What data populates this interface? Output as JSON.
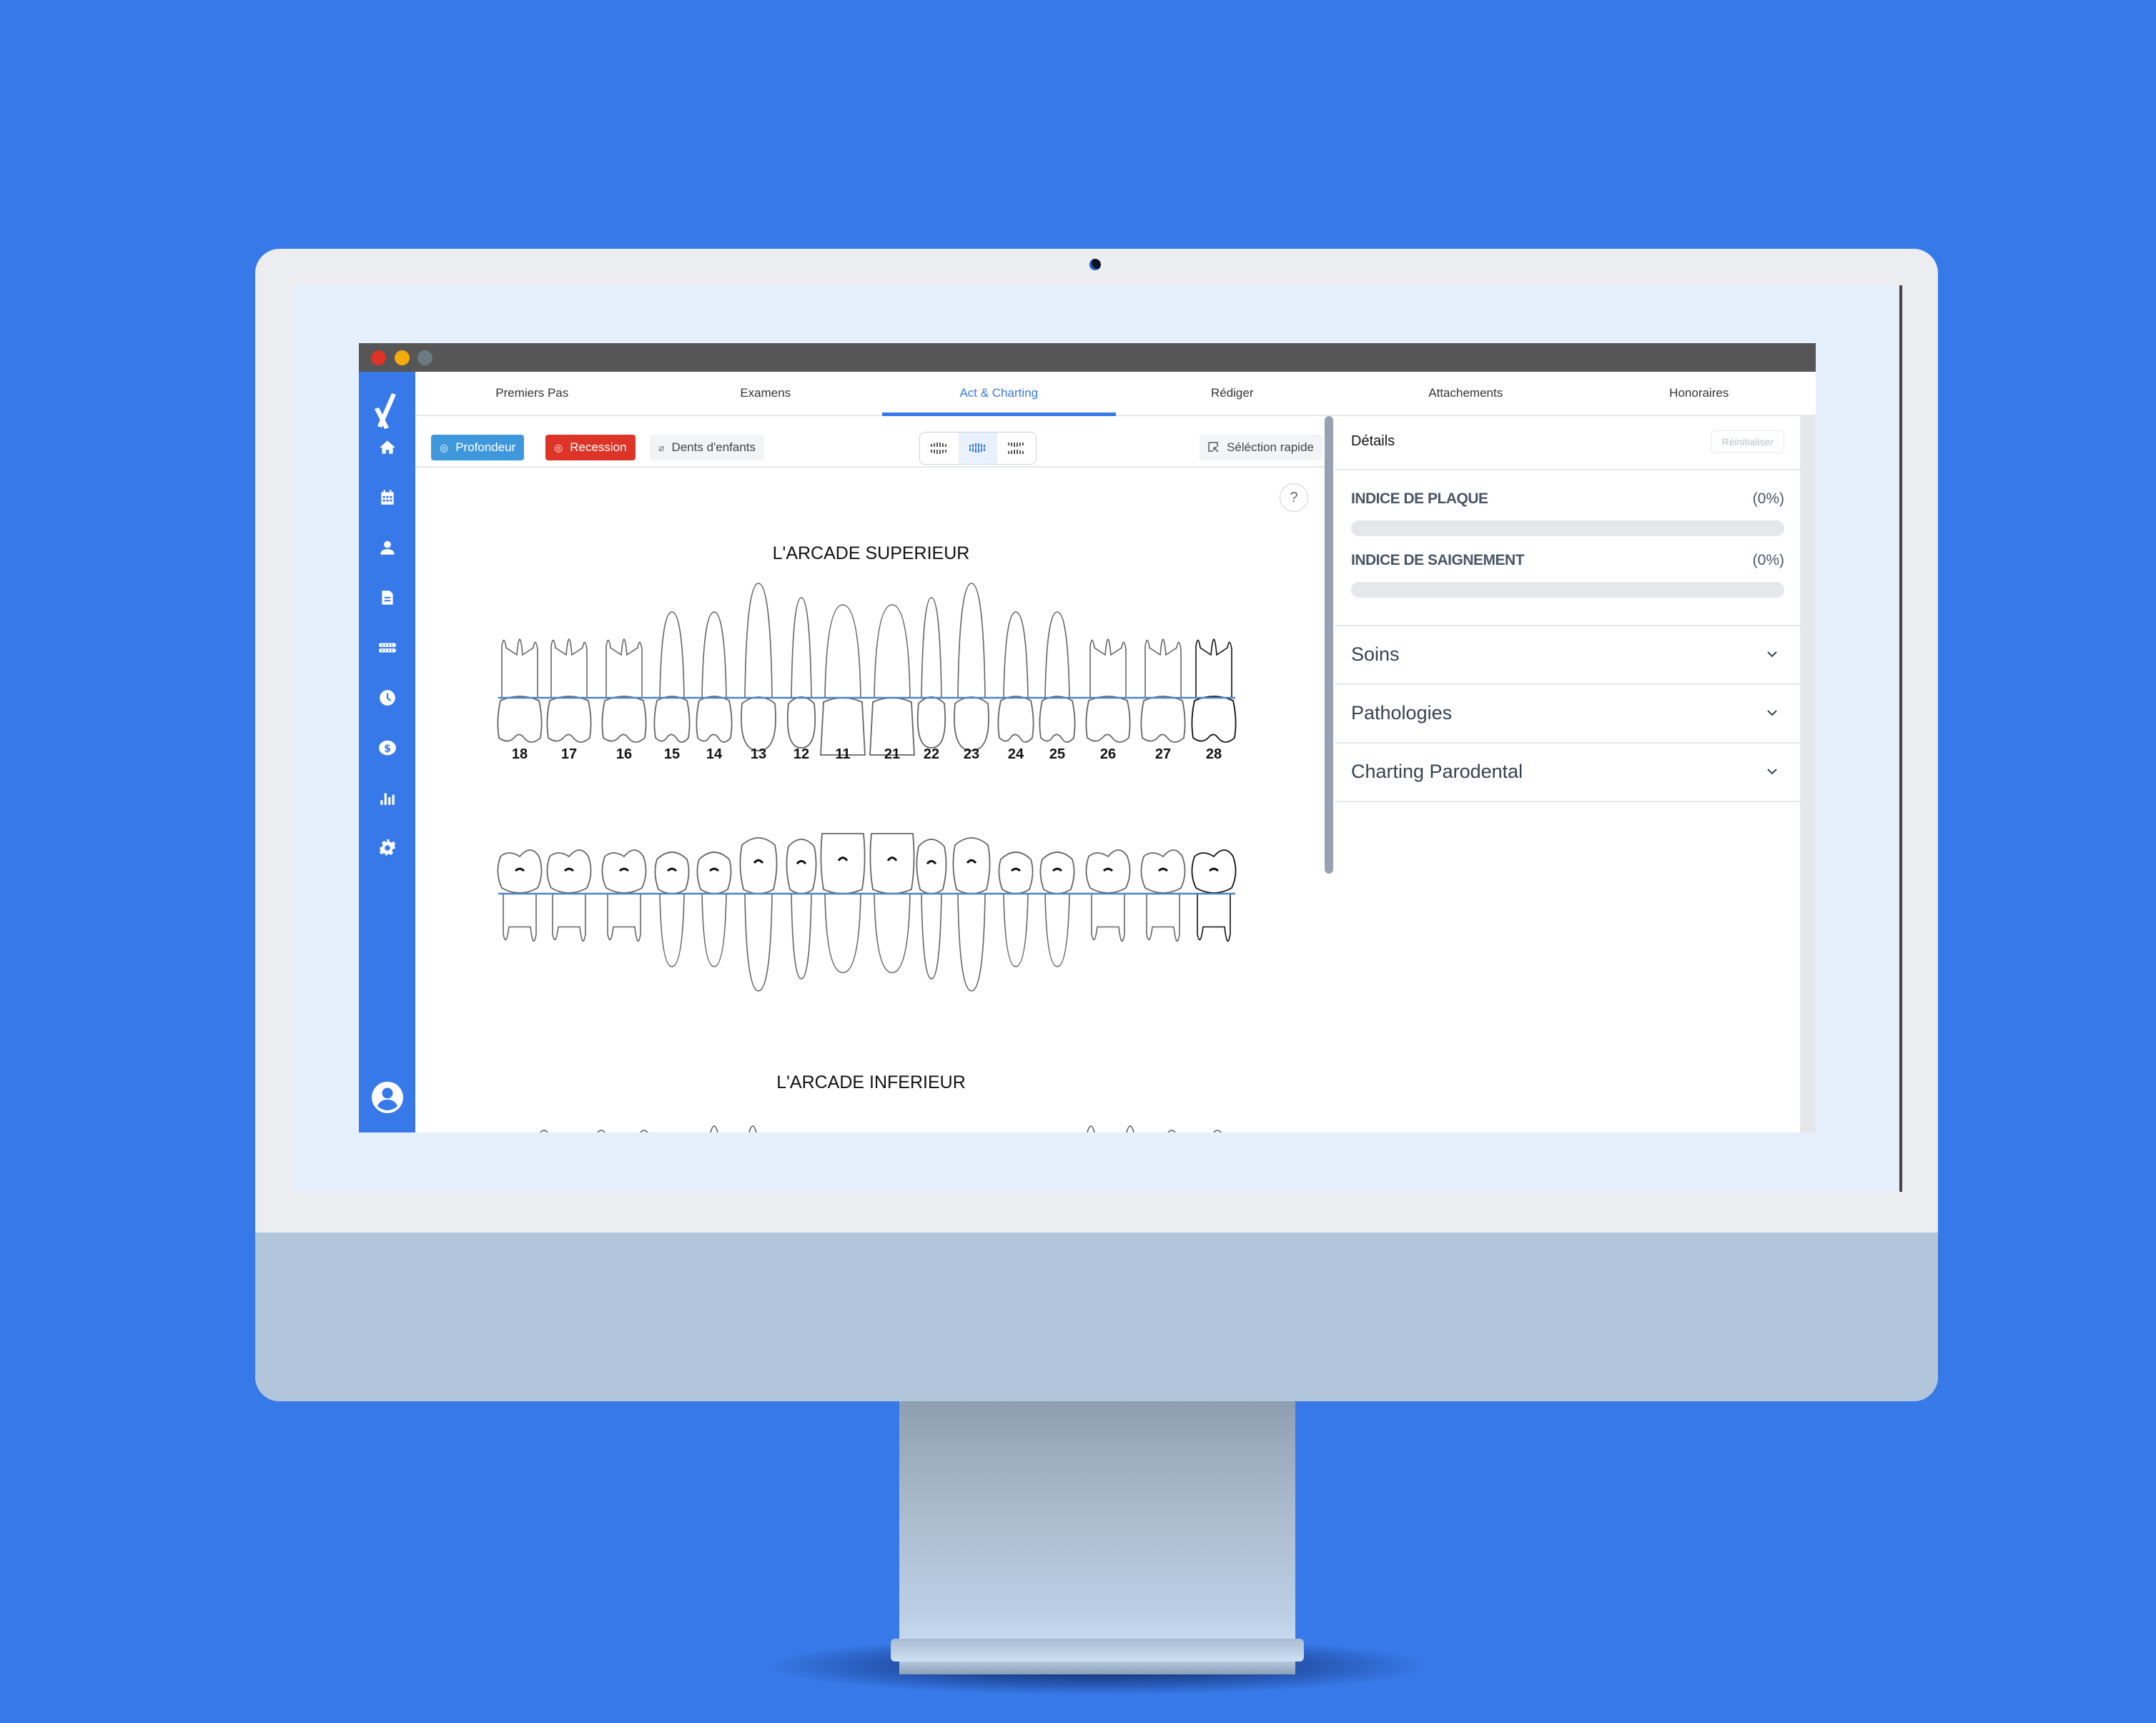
{
  "window": {
    "traffic_lights": [
      "close",
      "minimize",
      "maximize"
    ],
    "colors": {
      "close": "#dd3427",
      "minimize": "#f4ab0c",
      "maximize": "#6c7b83"
    }
  },
  "brand": {
    "accent": "#3779e8",
    "logo_icon": "check-x-logo-icon"
  },
  "sidebar": {
    "items": [
      {
        "icon": "home-icon",
        "label": "Accueil"
      },
      {
        "icon": "calendar-icon",
        "label": "Agenda"
      },
      {
        "icon": "user-icon",
        "label": "Patients"
      },
      {
        "icon": "document-icon",
        "label": "Documents"
      },
      {
        "icon": "teeth-icon",
        "label": "Charting"
      },
      {
        "icon": "clock-icon",
        "label": "Historique"
      },
      {
        "icon": "dollar-icon",
        "label": "Paiements"
      },
      {
        "icon": "bar-chart-icon",
        "label": "Statistiques"
      },
      {
        "icon": "gear-icon",
        "label": "Paramètres"
      }
    ],
    "profile_icon": "account-circle-icon"
  },
  "tabs": [
    {
      "label": "Premiers Pas",
      "active": false
    },
    {
      "label": "Examens",
      "active": false
    },
    {
      "label": "Act & Charting",
      "active": true
    },
    {
      "label": "Rédiger",
      "active": false
    },
    {
      "label": "Attachements",
      "active": false
    },
    {
      "label": "Honoraires",
      "active": false
    }
  ],
  "toolbar": {
    "profondeur_label": "Profondeur",
    "recession_label": "Recession",
    "dents_enfants_label": "Dents d'enfants",
    "view_modes": [
      {
        "icon": "both-arches-apart-icon",
        "active": false
      },
      {
        "icon": "both-arches-closed-icon",
        "active": true
      },
      {
        "icon": "arches-inverted-icon",
        "active": false
      }
    ],
    "quick_select_label": "Séléction rapide"
  },
  "chart": {
    "help_label": "?",
    "upper_title": "L'ARCADE SUPERIEUR",
    "lower_title": "L'ARCADE INFERIEUR",
    "upper_teeth": [
      {
        "num": "18",
        "type": "molar"
      },
      {
        "num": "17",
        "type": "molar"
      },
      {
        "num": "16",
        "type": "molar"
      },
      {
        "num": "15",
        "type": "premolar"
      },
      {
        "num": "14",
        "type": "premolar"
      },
      {
        "num": "13",
        "type": "canine"
      },
      {
        "num": "12",
        "type": "lateral"
      },
      {
        "num": "11",
        "type": "central"
      },
      {
        "num": "21",
        "type": "central"
      },
      {
        "num": "22",
        "type": "lateral"
      },
      {
        "num": "23",
        "type": "canine"
      },
      {
        "num": "24",
        "type": "premolar"
      },
      {
        "num": "25",
        "type": "premolar"
      },
      {
        "num": "26",
        "type": "molar"
      },
      {
        "num": "27",
        "type": "molar"
      },
      {
        "num": "28",
        "type": "molar",
        "selected": true
      }
    ],
    "lower_view_teeth": [
      {
        "num": "18",
        "type": "molar"
      },
      {
        "num": "17",
        "type": "molar"
      },
      {
        "num": "16",
        "type": "molar"
      },
      {
        "num": "15",
        "type": "premolar"
      },
      {
        "num": "14",
        "type": "premolar"
      },
      {
        "num": "13",
        "type": "canine"
      },
      {
        "num": "12",
        "type": "lateral"
      },
      {
        "num": "11",
        "type": "central"
      },
      {
        "num": "21",
        "type": "central"
      },
      {
        "num": "22",
        "type": "lateral"
      },
      {
        "num": "23",
        "type": "canine"
      },
      {
        "num": "24",
        "type": "premolar"
      },
      {
        "num": "25",
        "type": "premolar"
      },
      {
        "num": "26",
        "type": "molar"
      },
      {
        "num": "27",
        "type": "molar"
      },
      {
        "num": "28",
        "type": "molar",
        "selected": true
      }
    ]
  },
  "details": {
    "title": "Détails",
    "reset_label": "Réinitialiser",
    "metrics": [
      {
        "label": "INDICE DE PLAQUE",
        "value": "(0%)",
        "percent": 0
      },
      {
        "label": "INDICE DE SAIGNEMENT",
        "value": "(0%)",
        "percent": 0
      }
    ],
    "sections": [
      {
        "label": "Soins",
        "expanded": false
      },
      {
        "label": "Pathologies",
        "expanded": false
      },
      {
        "label": "Charting Parodental",
        "expanded": false
      }
    ]
  }
}
